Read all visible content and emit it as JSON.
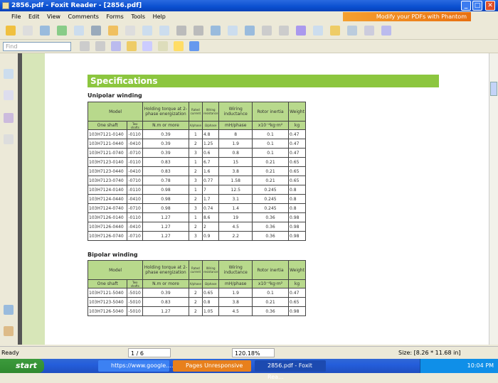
{
  "window": {
    "title": "2856.pdf - Foxit Reader - [2856.pdf]"
  },
  "menu": [
    "File",
    "Edit",
    "View",
    "Comments",
    "Forms",
    "Tools",
    "Help"
  ],
  "banner": "Modify your PDFs with Phantom",
  "find": {
    "placeholder": "Find"
  },
  "document": {
    "heading": "Specifications",
    "unipolar": {
      "title": "Unipolar winding",
      "headers": [
        "Model",
        "Holding torque at 2-phase energization",
        "Rated current",
        "Wiring resistance",
        "Wiring inductance",
        "Rotor inertia",
        "Weight"
      ],
      "units": [
        "One shaft",
        "Two shafts",
        "N.m or more",
        "A/phase",
        "Ω/phase",
        "mH/phase",
        "x10⁻⁴kg·m²",
        "kg"
      ],
      "rows": [
        [
          "103H7121-0140",
          "-0110",
          "0.39",
          "1",
          "4.8",
          "8",
          "0.1",
          "0.47"
        ],
        [
          "103H7121-0440",
          "-0410",
          "0.39",
          "2",
          "1.25",
          "1.9",
          "0.1",
          "0.47"
        ],
        [
          "103H7121-0740",
          "-0710",
          "0.39",
          "3",
          "0.6",
          "0.8",
          "0.1",
          "0.47"
        ],
        [
          "103H7123-0140",
          "-0110",
          "0.83",
          "1",
          "6.7",
          "15",
          "0.21",
          "0.65"
        ],
        [
          "103H7123-0440",
          "-0410",
          "0.83",
          "2",
          "1.6",
          "3.8",
          "0.21",
          "0.65"
        ],
        [
          "103H7123-0740",
          "-0710",
          "0.78",
          "3",
          "0.77",
          "1.58",
          "0.21",
          "0.65"
        ],
        [
          "103H7124-0140",
          "-0110",
          "0.98",
          "1",
          "7",
          "12.5",
          "0.245",
          "0.8"
        ],
        [
          "103H7124-0440",
          "-0410",
          "0.98",
          "2",
          "1.7",
          "3.1",
          "0.245",
          "0.8"
        ],
        [
          "103H7124-0740",
          "-0710",
          "0.98",
          "3",
          "0.74",
          "1.4",
          "0.245",
          "0.8"
        ],
        [
          "103H7126-0140",
          "-0110",
          "1.27",
          "1",
          "8.6",
          "19",
          "0.36",
          "0.98"
        ],
        [
          "103H7126-0440",
          "-0410",
          "1.27",
          "2",
          "2",
          "4.5",
          "0.36",
          "0.98"
        ],
        [
          "103H7126-0740",
          "-0710",
          "1.27",
          "3",
          "0.9",
          "2.2",
          "0.36",
          "0.98"
        ]
      ]
    },
    "bipolar": {
      "title": "Bipolar winding",
      "headers": [
        "Model",
        "Holding torque at 2-phase energization",
        "Rated current",
        "Wiring resistance",
        "Wiring inductance",
        "Rotor inertia",
        "Weight"
      ],
      "units": [
        "One shaft",
        "Two shafts",
        "N.m or more",
        "A/phase",
        "Ω/phase",
        "mH/phase",
        "x10⁻⁴kg·m²",
        "kg"
      ],
      "rows": [
        [
          "103H7121-5040",
          "-5010",
          "0.39",
          "2",
          "0.65",
          "1.9",
          "0.1",
          "0.47"
        ],
        [
          "103H7123-5040",
          "-5010",
          "0.83",
          "2",
          "0.8",
          "3.8",
          "0.21",
          "0.65"
        ],
        [
          "103H7126-5040",
          "-5010",
          "1.27",
          "2",
          "1.05",
          "4.5",
          "0.36",
          "0.98"
        ]
      ]
    }
  },
  "status": {
    "text": "Ready",
    "page": "1 / 6",
    "zoom": "120.18%",
    "size": "Size: [8.26 * 11.68 in]"
  },
  "taskbar": {
    "start": "start",
    "tasks": [
      "https://www.google....",
      "Pages Unresponsive",
      "2856.pdf - Foxit Rea..."
    ],
    "clock": "10:04 PM"
  }
}
